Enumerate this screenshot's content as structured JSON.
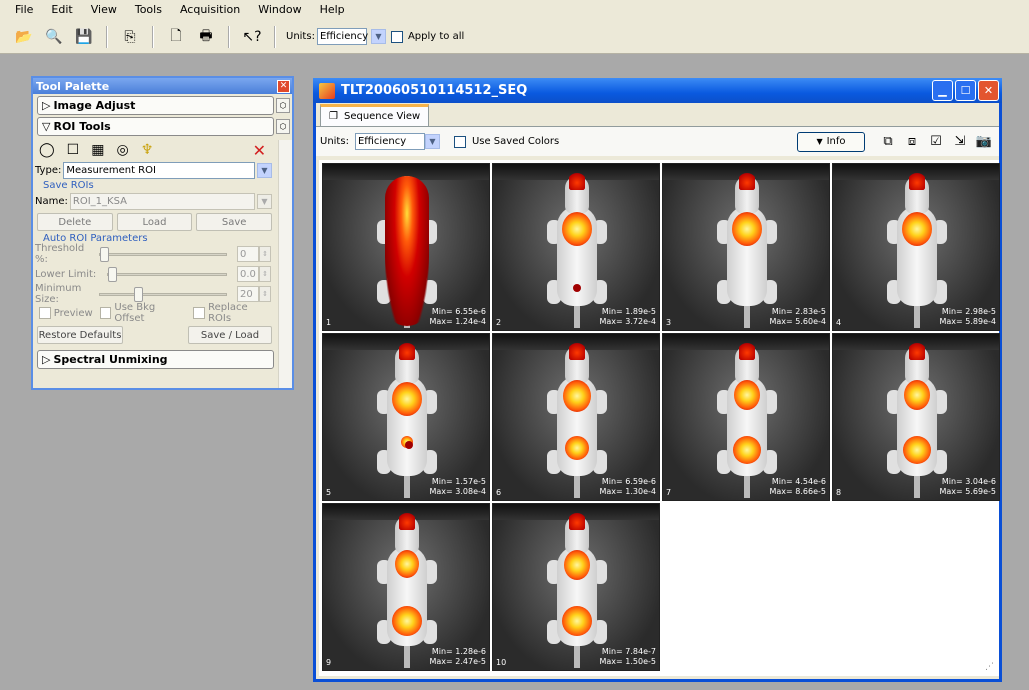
{
  "menu": [
    "File",
    "Edit",
    "View",
    "Tools",
    "Acquisition",
    "Window",
    "Help"
  ],
  "toolbar": {
    "units_label": "Units:",
    "units_value": "Efficiency",
    "apply_all_label": "Apply to all"
  },
  "palette": {
    "title": "Tool Palette",
    "image_adjust": "Image Adjust",
    "roi_tools": "ROI Tools",
    "type_label": "Type:",
    "type_value": "Measurement ROI",
    "save_rois_label": "Save ROIs",
    "name_label": "Name:",
    "name_value": "ROI_1_KSA",
    "delete": "Delete",
    "load": "Load",
    "save": "Save",
    "auto_roi_label": "Auto ROI Parameters",
    "threshold_label": "Threshold %:",
    "threshold_value": "0",
    "lower_limit_label": "Lower Limit:",
    "lower_limit_value": "0.0",
    "min_size_label": "Minimum Size:",
    "min_size_value": "20",
    "preview": "Preview",
    "bkg_offset": "Use Bkg Offset",
    "replace_rois": "Replace ROIs",
    "restore_defaults": "Restore Defaults",
    "save_load": "Save / Load",
    "spectral_unmixing": "Spectral Unmixing"
  },
  "seq": {
    "title": "TLT20060510114512_SEQ",
    "tab": "Sequence View",
    "units_label": "Units:",
    "units_value": "Efficiency",
    "use_saved_colors": "Use Saved Colors",
    "info": "Info",
    "frames": [
      {
        "num": "1",
        "min": "Min= 6.55e-6",
        "max": "Max= 1.24e-4"
      },
      {
        "num": "2",
        "min": "Min= 1.89e-5",
        "max": "Max= 3.72e-4"
      },
      {
        "num": "3",
        "min": "Min= 2.83e-5",
        "max": "Max= 5.60e-4"
      },
      {
        "num": "4",
        "min": "Min= 2.98e-5",
        "max": "Max= 5.89e-4"
      },
      {
        "num": "5",
        "min": "Min= 1.57e-5",
        "max": "Max= 3.08e-4"
      },
      {
        "num": "6",
        "min": "Min= 6.59e-6",
        "max": "Max= 1.30e-4"
      },
      {
        "num": "7",
        "min": "Min= 4.54e-6",
        "max": "Max= 8.66e-5"
      },
      {
        "num": "8",
        "min": "Min= 3.04e-6",
        "max": "Max= 5.69e-5"
      },
      {
        "num": "9",
        "min": "Min= 1.28e-6",
        "max": "Max= 2.47e-5"
      },
      {
        "num": "10",
        "min": "Min= 7.84e-7",
        "max": "Max= 1.50e-5"
      }
    ]
  },
  "colors": {
    "accent": "#0a5ae0",
    "palette_border": "#5a8ee6"
  }
}
